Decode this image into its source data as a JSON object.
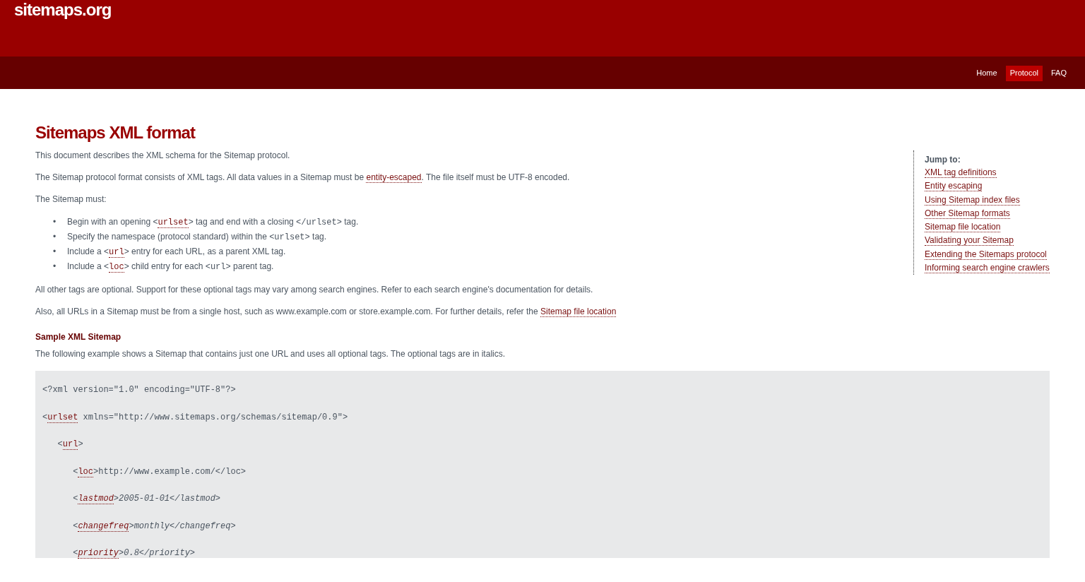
{
  "site_title": "sitemaps.org",
  "nav": [
    {
      "label": "Home",
      "selected": false
    },
    {
      "label": "Protocol",
      "selected": true
    },
    {
      "label": "FAQ",
      "selected": false
    }
  ],
  "heading": "Sitemaps XML format",
  "jump_to": {
    "title": "Jump to:",
    "links": [
      "XML tag definitions",
      "Entity escaping",
      "Using Sitemap index files",
      "Other Sitemap formats",
      "Sitemap file location",
      "Validating your Sitemap",
      "Extending the Sitemaps protocol",
      "Informing search engine crawlers"
    ]
  },
  "intro": [
    [
      {
        "kind": "text",
        "text": "This document describes the XML schema for the Sitemap protocol."
      }
    ],
    [
      {
        "kind": "text",
        "text": "The Sitemap protocol format consists of XML tags. All data values in a Sitemap must be "
      },
      {
        "kind": "link",
        "text": "entity-escaped"
      },
      {
        "kind": "text",
        "text": ". The file itself must be UTF-8 encoded."
      }
    ],
    [
      {
        "kind": "text",
        "text": "The Sitemap must:"
      }
    ]
  ],
  "must_list": [
    {
      "marker": "•",
      "parts": [
        {
          "kind": "text",
          "text": "Begin with an opening <"
        },
        {
          "kind": "tag",
          "text": "urlset"
        },
        {
          "kind": "text",
          "text": "> tag and end with a closing "
        },
        {
          "kind": "code",
          "text": "</urlset>"
        },
        {
          "kind": "text",
          "text": " tag."
        }
      ]
    },
    {
      "marker": "•",
      "parts": [
        {
          "kind": "text",
          "text": "Specify the namespace (protocol standard) within the "
        },
        {
          "kind": "code",
          "text": "<urlset>"
        },
        {
          "kind": "text",
          "text": " tag."
        }
      ]
    },
    {
      "marker": "•",
      "parts": [
        {
          "kind": "text",
          "text": "Include a <"
        },
        {
          "kind": "tag",
          "text": "url"
        },
        {
          "kind": "text",
          "text": "> entry for each URL, as a parent XML tag."
        }
      ]
    },
    {
      "marker": "•",
      "parts": [
        {
          "kind": "text",
          "text": "Include a <"
        },
        {
          "kind": "tag",
          "text": "loc"
        },
        {
          "kind": "text",
          "text": "> child entry for each "
        },
        {
          "kind": "code",
          "text": "<url>"
        },
        {
          "kind": "text",
          "text": " parent tag."
        }
      ]
    }
  ],
  "after_list": [
    [
      {
        "kind": "text",
        "text": "All other tags are optional. Support for these optional tags may vary among search engines. Refer to each search engine's documentation for details."
      }
    ],
    [
      {
        "kind": "text",
        "text": "Also, all URLs in a Sitemap must be from a single host, such as www.example.com or store.example.com. For further details, refer the "
      },
      {
        "kind": "link",
        "text": "Sitemap file location"
      }
    ]
  ],
  "sample": {
    "title": "Sample XML Sitemap",
    "description": "The following example shows a Sitemap that contains just one URL and uses all optional tags. The optional tags are in italics.",
    "code_lines": [
      [
        {
          "kind": "text",
          "text": "<?xml version=\"1.0\" encoding=\"UTF-8\"?>"
        }
      ],
      [
        {
          "kind": "text",
          "text": "<"
        },
        {
          "kind": "tag",
          "text": "urlset"
        },
        {
          "kind": "text",
          "text": " xmlns=\"http://www.sitemaps.org/schemas/sitemap/0.9\">"
        }
      ],
      [
        {
          "kind": "text",
          "text": "   <"
        },
        {
          "kind": "tag",
          "text": "url"
        },
        {
          "kind": "text",
          "text": ">"
        }
      ],
      [
        {
          "kind": "text",
          "text": "      <"
        },
        {
          "kind": "tag",
          "text": "loc"
        },
        {
          "kind": "text",
          "text": ">http://www.example.com/</loc>"
        }
      ],
      [
        {
          "kind": "text",
          "text": "      <"
        },
        {
          "kind": "itag",
          "text": "lastmod"
        },
        {
          "kind": "italic",
          "text": ">2005-01-01</lastmod>"
        }
      ],
      [
        {
          "kind": "text",
          "text": "      <"
        },
        {
          "kind": "itag",
          "text": "changefreq"
        },
        {
          "kind": "italic",
          "text": ">monthly</changefreq>"
        }
      ],
      [
        {
          "kind": "text",
          "text": "      <"
        },
        {
          "kind": "itag",
          "text": "priority"
        },
        {
          "kind": "italic",
          "text": ">0.8</priority>"
        }
      ]
    ]
  }
}
